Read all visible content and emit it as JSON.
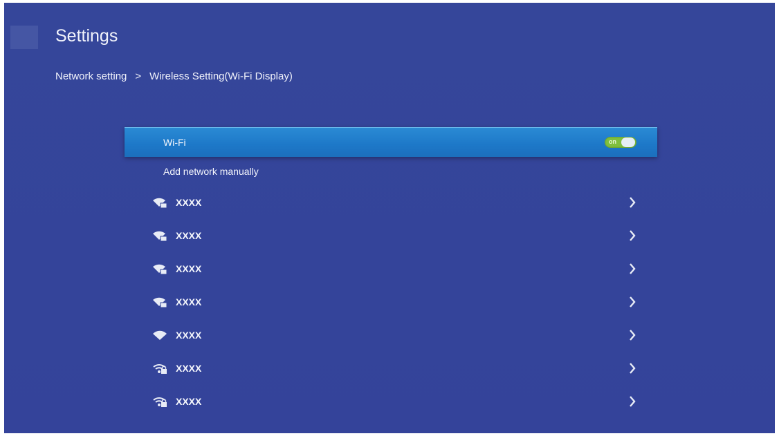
{
  "header": {
    "title": "Settings",
    "breadcrumb": {
      "parent": "Network setting",
      "separator": ">",
      "current": "Wireless Setting(Wi-Fi Display)"
    }
  },
  "wifi": {
    "label": "Wi-Fi",
    "toggle_state": "on",
    "toggle_text": "on"
  },
  "add_network": {
    "label": "Add network manually"
  },
  "networks": [
    {
      "name": "XXXX",
      "icon": "wifi-locked-icon"
    },
    {
      "name": "XXXX",
      "icon": "wifi-locked-icon"
    },
    {
      "name": "XXXX",
      "icon": "wifi-locked-icon"
    },
    {
      "name": "XXXX",
      "icon": "wifi-locked-icon"
    },
    {
      "name": "XXXX",
      "icon": "wifi-open-icon"
    },
    {
      "name": "XXXX",
      "icon": "wifi-lock-icon"
    },
    {
      "name": "XXXX",
      "icon": "wifi-lock-icon"
    }
  ],
  "colors": {
    "background": "#35469a",
    "selected_row": "#1d78c8",
    "toggle_on": "#7fbf3e",
    "text": "#f1f3fb"
  }
}
